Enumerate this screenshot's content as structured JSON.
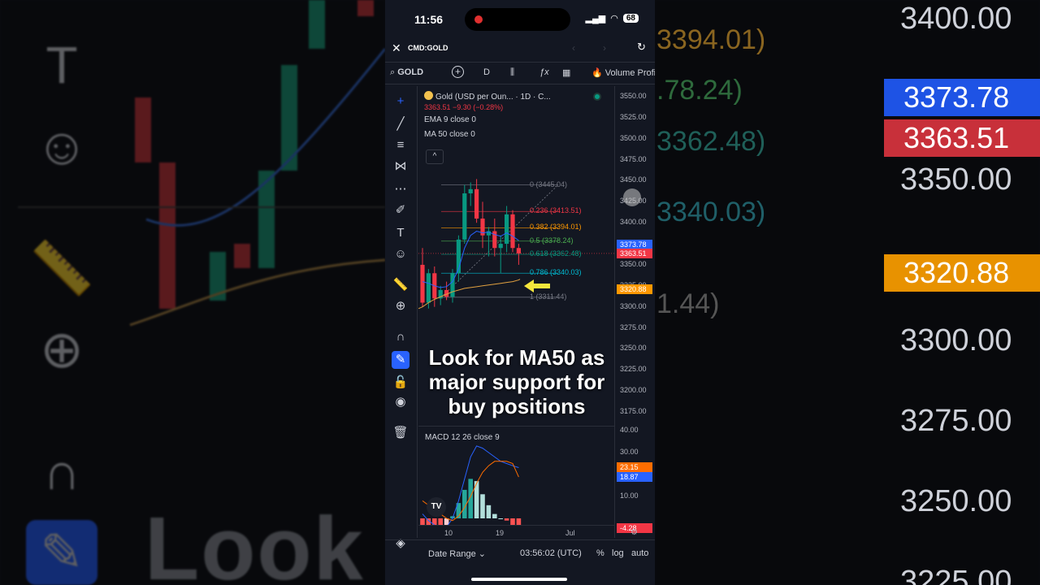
{
  "status": {
    "time": "11:56",
    "battery": "68"
  },
  "header": {
    "close_icon": "close-icon",
    "symbol": "CMD:GOLD",
    "prev_icon": "chevron-left-icon",
    "next_icon": "chevron-right-icon",
    "reload_icon": "reload-icon"
  },
  "toolbar": {
    "search_symbol": "GOLD",
    "timeframe": "D",
    "indicator_label": "Volume Profi"
  },
  "legend": {
    "title": "Gold (USD per Oun...  · 1D · C...",
    "price_line": "3363.51  −9.30  (−0.28%)",
    "ema": "EMA 9 close 0",
    "ma": "MA 50 close 0",
    "macd": "MACD 12 26 close 9"
  },
  "fib_levels": [
    {
      "label": "0 (3445.04)",
      "price": 3445.04,
      "color": "#787b86"
    },
    {
      "label": "0.236 (3413.51)",
      "price": 3413.51,
      "color": "#f23645"
    },
    {
      "label": "0.382 (3394.01)",
      "price": 3394.01,
      "color": "#ff9800"
    },
    {
      "label": "0.5 (3378.24)",
      "price": 3378.24,
      "color": "#4caf50"
    },
    {
      "label": "0.618 (3362.48)",
      "price": 3362.48,
      "color": "#089981"
    },
    {
      "label": "0.786 (3340.03)",
      "price": 3340.03,
      "color": "#00bcd4"
    },
    {
      "label": "1 (3311.44)",
      "price": 3311.44,
      "color": "#787b86"
    }
  ],
  "price_axis": [
    "3550.00",
    "3525.00",
    "3500.00",
    "3475.00",
    "3450.00",
    "3425.00",
    "3400.00",
    "3375.00",
    "3350.00",
    "3325.00",
    "3300.00",
    "3275.00",
    "3250.00",
    "3225.00",
    "3200.00",
    "3175.00"
  ],
  "price_badges": [
    {
      "text": "3373.78",
      "price": 3373.78,
      "color": "#2962ff"
    },
    {
      "text": "3363.51",
      "price": 3363.51,
      "color": "#f23645"
    },
    {
      "text": "3320.88",
      "price": 3320.88,
      "color": "#ff9800"
    }
  ],
  "macd_axis": [
    "40.00",
    "30.00",
    "10.00"
  ],
  "macd_badges": [
    {
      "text": "23.15",
      "value": 23.15,
      "color": "#ff6d00"
    },
    {
      "text": "18.87",
      "value": 18.87,
      "color": "#2962ff"
    },
    {
      "text": "-4.28",
      "value": -4.28,
      "color": "#f23645"
    }
  ],
  "time_axis": [
    "10",
    "19",
    "Jul"
  ],
  "caption": "Look for MA50 as major support for buy positions",
  "bottom_bar": {
    "date_range": "Date Range",
    "clock": "03:56:02 (UTC)",
    "percent": "%",
    "log": "log",
    "auto": "auto"
  },
  "background": {
    "prices": [
      "3400.00",
      "3350.00",
      "3300.00",
      "3275.00",
      "3250.00",
      "3225.00"
    ],
    "badges": [
      {
        "text": "3373.78",
        "color": "#1e53e5"
      },
      {
        "text": "3363.51",
        "color": "#c8303a"
      },
      {
        "text": "3320.88",
        "color": "#e89200"
      }
    ],
    "fibs": [
      "3394.01)",
      ".78.24)",
      "3362.48)",
      "3340.03)",
      "1.44)"
    ],
    "caption": "Look f    50 as"
  },
  "chart_data": {
    "type": "candlestick",
    "candles": [
      {
        "o": 3350,
        "h": 3370,
        "l": 3300,
        "c": 3305
      },
      {
        "o": 3305,
        "h": 3345,
        "l": 3298,
        "c": 3340
      },
      {
        "o": 3340,
        "h": 3348,
        "l": 3300,
        "c": 3310
      },
      {
        "o": 3310,
        "h": 3325,
        "l": 3302,
        "c": 3320
      },
      {
        "o": 3320,
        "h": 3330,
        "l": 3308,
        "c": 3312
      },
      {
        "o": 3312,
        "h": 3345,
        "l": 3305,
        "c": 3340
      },
      {
        "o": 3340,
        "h": 3385,
        "l": 3330,
        "c": 3380
      },
      {
        "o": 3380,
        "h": 3445,
        "l": 3375,
        "c": 3435
      },
      {
        "o": 3435,
        "h": 3448,
        "l": 3420,
        "c": 3440
      },
      {
        "o": 3440,
        "h": 3452,
        "l": 3400,
        "c": 3405
      },
      {
        "o": 3405,
        "h": 3425,
        "l": 3370,
        "c": 3385
      },
      {
        "o": 3385,
        "h": 3395,
        "l": 3360,
        "c": 3390
      },
      {
        "o": 3390,
        "h": 3405,
        "l": 3360,
        "c": 3370
      },
      {
        "o": 3370,
        "h": 3385,
        "l": 3340,
        "c": 3375
      },
      {
        "o": 3375,
        "h": 3420,
        "l": 3365,
        "c": 3410
      },
      {
        "o": 3410,
        "h": 3415,
        "l": 3365,
        "c": 3370
      },
      {
        "o": 3370,
        "h": 3375,
        "l": 3350,
        "c": 3363.51
      }
    ],
    "ma50": [
      3300,
      3305,
      3309,
      3312,
      3315,
      3318,
      3320,
      3322,
      3323,
      3324,
      3325,
      3326,
      3327,
      3328,
      3329,
      3330,
      3332
    ],
    "ema9": [
      3330,
      3328,
      3325,
      3323,
      3324,
      3330,
      3345,
      3370,
      3385,
      3390,
      3388,
      3389,
      3386,
      3384,
      3388,
      3384,
      3379
    ],
    "macd": [
      2,
      -1,
      -3,
      -5,
      -4,
      0,
      8,
      18,
      28,
      33,
      32,
      30,
      28,
      26,
      25,
      24,
      23.15
    ],
    "signal": [
      8,
      6,
      4,
      2,
      0,
      -1,
      1,
      5,
      10,
      16,
      21,
      24,
      26,
      26,
      26,
      25,
      18.87
    ],
    "histogram": [
      -4,
      -5,
      -5,
      -6,
      -4,
      1,
      7,
      13,
      18,
      17,
      11,
      6,
      2,
      0,
      -1,
      -3,
      -4.28
    ],
    "ylim": [
      3165,
      3560
    ],
    "macd_ylim": [
      -8,
      42
    ]
  }
}
